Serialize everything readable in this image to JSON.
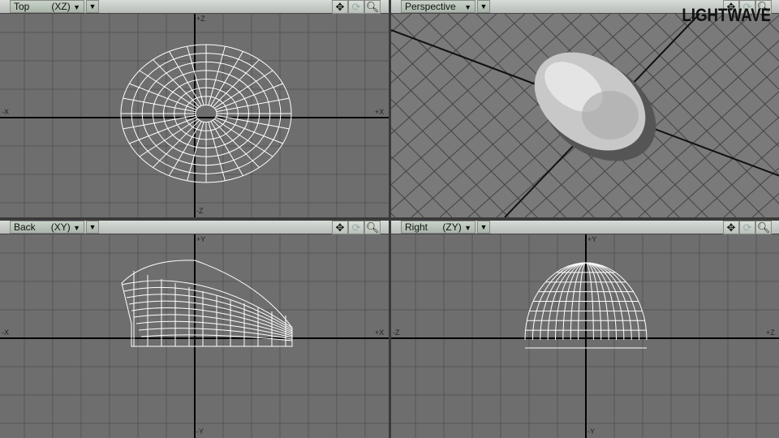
{
  "viewports": [
    {
      "name": "Top",
      "axes": "(XZ)",
      "axis_labels": {
        "top": "+Z",
        "bottom": "-Z",
        "left": "-X",
        "right": "+X"
      }
    },
    {
      "name": "Perspective",
      "axes": ""
    },
    {
      "name": "Back",
      "axes": "(XY)",
      "axis_labels": {
        "top": "+Y",
        "bottom": "-Y",
        "left": "-X",
        "right": "+X"
      }
    },
    {
      "name": "Right",
      "axes": "(ZY)",
      "axis_labels": {
        "top": "+Y",
        "bottom": "-Y",
        "left": "-Z",
        "right": "+Z"
      }
    }
  ],
  "logo": "LIGHTWAVE",
  "icons": [
    "move-icon",
    "rotate-icon",
    "zoom-icon"
  ]
}
